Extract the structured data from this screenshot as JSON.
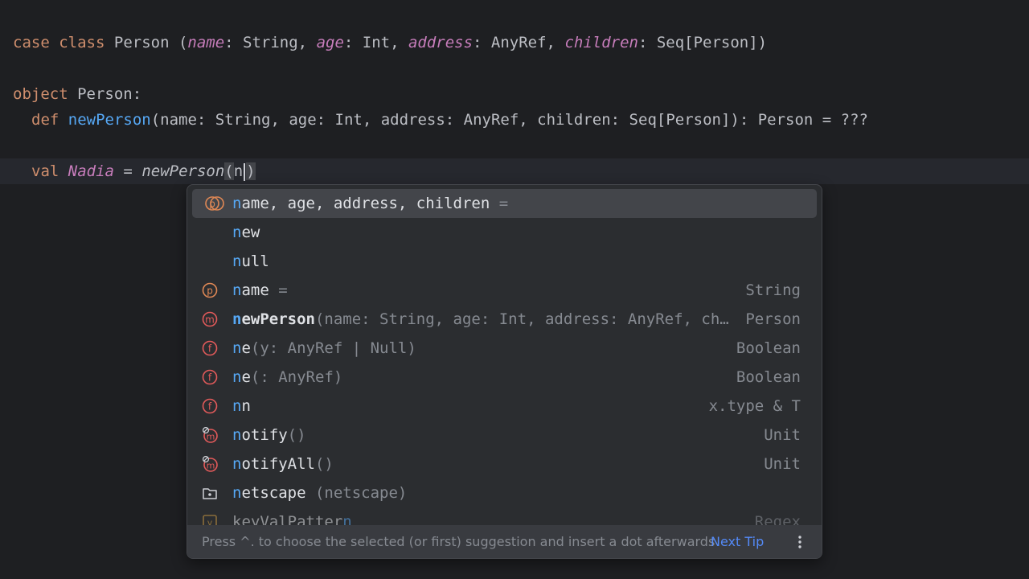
{
  "editor": {
    "line1": {
      "kw_case": "case",
      "kw_class": "class",
      "class_name": "Person",
      "open": " (",
      "p1": "name",
      "t1": ": String, ",
      "p2": "age",
      "t2": ": Int, ",
      "p3": "address",
      "t3": ": AnyRef, ",
      "p4": "children",
      "t4": ": Seq[Person])"
    },
    "line2": {
      "kw_object": "object",
      "name": "Person:"
    },
    "line3": {
      "kw_def": "def",
      "fn_name": "newPerson",
      "signature": "(name: String, age: Int, address: AnyRef, children: Seq[Person]): Person = ???"
    },
    "line4": {
      "kw_val": "val",
      "val_name": "Nadia",
      "eq": " = ",
      "call": "newPerson",
      "open_paren": "(",
      "typed": "n",
      "close_paren": ")"
    }
  },
  "completion": {
    "items": [
      {
        "icon": "parameters-icon",
        "match": "n",
        "rest": "ame, age, address, children",
        "tail": " =",
        "type": ""
      },
      {
        "icon": "",
        "match": "n",
        "rest": "ew",
        "tail": "",
        "type": ""
      },
      {
        "icon": "",
        "match": "n",
        "rest": "ull",
        "tail": "",
        "type": ""
      },
      {
        "icon": "parameter-icon",
        "match": "n",
        "rest": "ame",
        "tail": " =",
        "type": "String"
      },
      {
        "icon": "method-icon",
        "match": "n",
        "rest": "ewPerson",
        "tail": "(name: String, age: Int, address: AnyRef, ch…",
        "type": "Person"
      },
      {
        "icon": "function-icon",
        "match": "n",
        "rest": "e",
        "tail": "(y: AnyRef | Null)",
        "type": "Boolean"
      },
      {
        "icon": "function-icon",
        "match": "n",
        "rest": "e",
        "tail": "(: AnyRef)",
        "type": "Boolean"
      },
      {
        "icon": "function-icon",
        "match": "n",
        "rest": "n",
        "tail": "",
        "type": "x.type & T"
      },
      {
        "icon": "method-locked-icon",
        "match": "n",
        "rest": "otify",
        "tail": "()",
        "type": "Unit"
      },
      {
        "icon": "method-locked-icon",
        "match": "n",
        "rest": "otifyAll",
        "tail": "()",
        "type": "Unit"
      },
      {
        "icon": "package-icon",
        "match": "n",
        "rest": "etscape",
        "tail": "    (netscape)",
        "type": ""
      },
      {
        "icon": "value-icon",
        "match": "",
        "rest": "keyValPatter",
        "tail": "n",
        "type": "Regex"
      }
    ],
    "footer_hint": "Press ^. to choose the selected (or first) suggestion and insert a dot afterwards",
    "next_tip": "Next Tip"
  },
  "colors": {
    "background": "#1e1f22",
    "keyword": "#cf8e6d",
    "parameter": "#c77dbb",
    "function": "#56a8f5",
    "popup_bg": "#2b2d30",
    "selection": "#43454a",
    "link": "#548af7"
  }
}
